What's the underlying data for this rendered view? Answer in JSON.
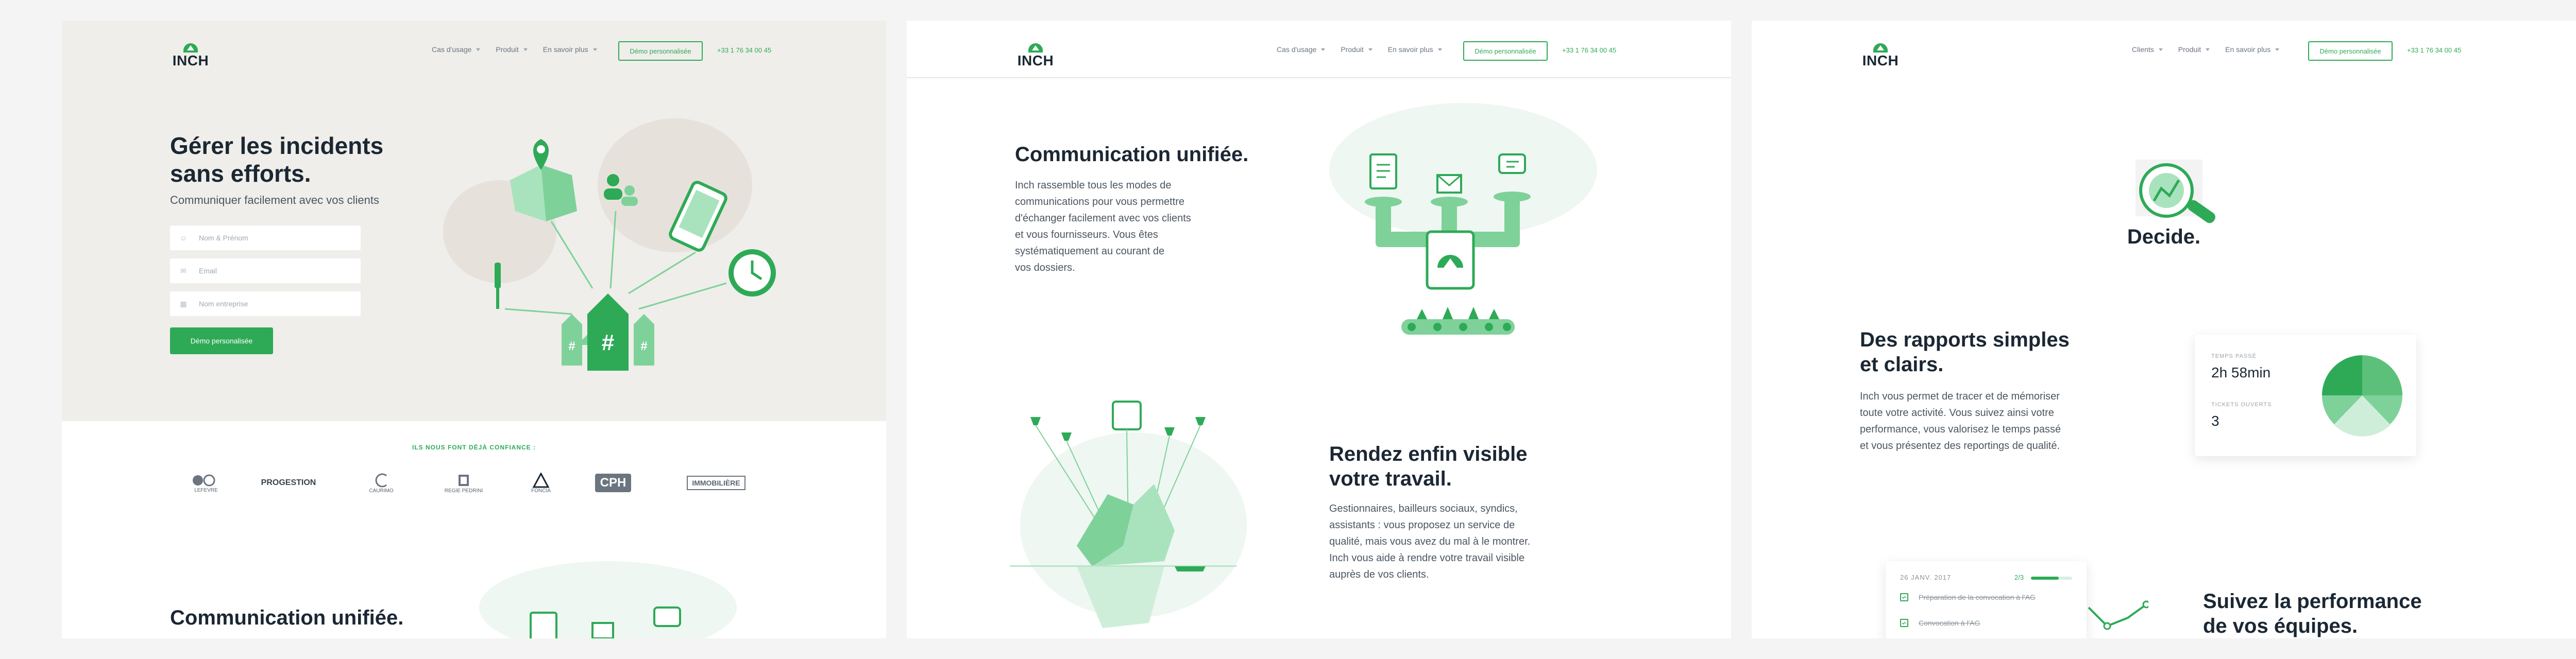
{
  "colors": {
    "accent": "#2eaa57",
    "dark": "#1b2733",
    "hero_bg": "#efeeea"
  },
  "brand": {
    "name": "INCH"
  },
  "panels": [
    {
      "nav": {
        "items": [
          "Cas d'usage",
          "Produit",
          "En savoir plus"
        ],
        "demo": "Démo personnalisée",
        "phone": "+33 1 76 34 00 45"
      },
      "hero": {
        "title_line1": "Gérer les incidents",
        "title_line2": "sans efforts.",
        "subtitle": "Communiquer facilement avec vos clients",
        "fields": [
          {
            "placeholder": "Nom & Prénom",
            "icon": "user-icon"
          },
          {
            "placeholder": "Email",
            "icon": "mail-icon"
          },
          {
            "placeholder": "Nom entreprise",
            "icon": "building-icon"
          }
        ],
        "submit": "Démo personalisée"
      },
      "trust_title": "ILS NOUS FONT DÉJÀ CONFIANCE :",
      "clients": [
        "LEFEVRE",
        "PROGESTION",
        "CAURIMO",
        "REGIE PEDRINI",
        "FONCIA",
        "CPH",
        "IMMOBILIÈRE"
      ],
      "bottom_heading": "Communication unifiée."
    },
    {
      "nav": {
        "items": [
          "Cas d'usage",
          "Produit",
          "En savoir plus"
        ],
        "demo": "Démo personnalisée",
        "phone": "+33 1 76 34 00 45"
      },
      "section1": {
        "title": "Communication unifiée.",
        "lines": [
          "Inch rassemble tous les modes de",
          "communications pour vous permettre",
          "d'échanger facilement avec vos clients",
          "et vous fournisseurs. Vous êtes",
          "systématiquement au courant de",
          "vos dossiers."
        ]
      },
      "section2": {
        "title_line1": "Rendez enfin visible",
        "title_line2": "votre travail.",
        "lines": [
          "Gestionnaires, bailleurs sociaux, syndics,",
          "assistants : vous proposez un service de",
          "qualité, mais vous avez du mal à le montrer.",
          "Inch vous aide à rendre votre travail visible",
          "auprès de vos clients."
        ]
      }
    },
    {
      "nav": {
        "items": [
          "Clients",
          "Produit",
          "En savoir plus"
        ],
        "demo": "Démo personnalisée",
        "phone": "+33 1 76 34 00 45"
      },
      "decide": "Decide.",
      "section1": {
        "title_line1": "Des rapports simples",
        "title_line2": "et clairs.",
        "lines": [
          "Inch vous permet de tracer et de mémoriser",
          "toute votre activité. Vous suivez ainsi votre",
          "performance, vous valorisez le temps passé",
          "et vous présentez des reportings de qualité."
        ]
      },
      "stats": {
        "time_label": "TEMPS PASSÉ",
        "time_value": "2h 58min",
        "tickets_label": "TICKETS OUVERTS",
        "tickets_value": "3"
      },
      "tasks": {
        "date": "26 JANV. 2017",
        "progress": "2/3",
        "progress_fraction": 0.67,
        "items": [
          "Préparation de la convocation à l'AG",
          "Convocation à l'AG"
        ]
      },
      "section2": {
        "title_line1": "Suivez la performance",
        "title_line2": "de vos équipes."
      }
    }
  ]
}
